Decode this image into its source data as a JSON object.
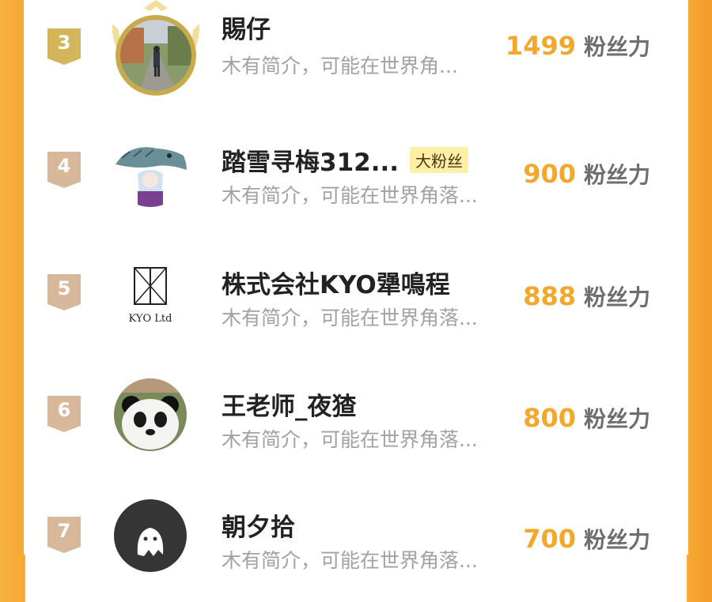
{
  "colors": {
    "accent": "#f3a72b",
    "rank_badge_gold": "#d4b55a",
    "rank_badge_tan": "#d8b89a",
    "badge_bg": "#fdefa6"
  },
  "fans": [
    {
      "rank": "3",
      "name": "賜仔",
      "badge": "",
      "bio": "木有简介，可能在世界角...",
      "score": "1499",
      "unit": "粉丝力",
      "avatar_icon": "hiker-photo-avatar",
      "crown": true
    },
    {
      "rank": "4",
      "name": "踏雪寻梅312...",
      "badge": "大粉丝",
      "bio": "木有简介，可能在世界角落...",
      "score": "900",
      "unit": "粉丝力",
      "avatar_icon": "fish-anime-avatar",
      "crown": false
    },
    {
      "rank": "5",
      "name": "株式会社KYO犟鳴程",
      "badge": "",
      "bio": "木有简介，可能在世界角落...",
      "score": "888",
      "unit": "粉丝力",
      "avatar_icon": "kyo-ltd-logo-avatar",
      "crown": false
    },
    {
      "rank": "6",
      "name": "王老师_夜猹",
      "badge": "",
      "bio": "木有简介，可能在世界角落...",
      "score": "800",
      "unit": "粉丝力",
      "avatar_icon": "panda-avatar",
      "crown": false
    },
    {
      "rank": "7",
      "name": "朝夕拾",
      "badge": "",
      "bio": "木有简介，可能在世界角落...",
      "score": "700",
      "unit": "粉丝力",
      "avatar_icon": "default-ghost-avatar",
      "crown": false
    }
  ],
  "logo_text": "KYO Ltd"
}
